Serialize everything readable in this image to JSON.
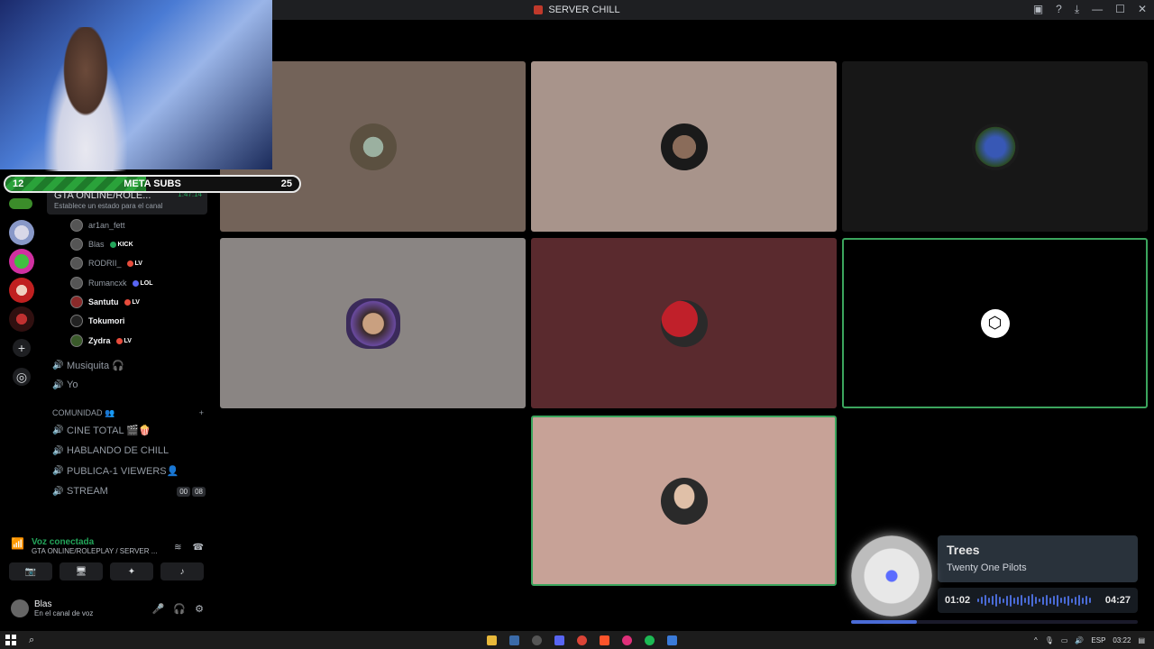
{
  "window": {
    "title": "SERVER CHILL"
  },
  "subgoal": {
    "current": "12",
    "label": "META SUBS",
    "goal": "25",
    "progress": 0.48
  },
  "channel_header": {
    "name": "GTA ONLINE/ROLE...",
    "time": "1:47:14",
    "status": "Establece un estado para el canal"
  },
  "members": [
    {
      "name": "ar1an_fett",
      "badge": "",
      "active": false
    },
    {
      "name": "Blas",
      "badge": "KICK",
      "active": false
    },
    {
      "name": "RODRII_",
      "badge": "LV",
      "active": false
    },
    {
      "name": "Rumancxk",
      "badge": "LOL",
      "active": false
    },
    {
      "name": "Santutu",
      "badge": "LV",
      "active": true
    },
    {
      "name": "Tokumori",
      "badge": "",
      "active": true
    },
    {
      "name": "Zydra",
      "badge": "LV",
      "active": true
    }
  ],
  "voice_channels_top": [
    {
      "name": "Musiquita 🎧"
    },
    {
      "name": "Yo"
    }
  ],
  "category": {
    "name": "COMUNIDAD 👥",
    "add": "+"
  },
  "voice_channels": [
    {
      "name": "CINE TOTAL 🎬🍿"
    },
    {
      "name": "HABLANDO DE CHILL"
    },
    {
      "name": "PUBLICA-1 VIEWERS👤"
    },
    {
      "name": "STREAM",
      "counts": [
        "00",
        "08"
      ]
    }
  ],
  "voice_panel": {
    "status": "Voz conectada",
    "channel": "GTA ONLINE/ROLEPLAY / SERVER ..."
  },
  "user": {
    "name": "Blas",
    "status": "En el canal de voz"
  },
  "music": {
    "song": "Trees",
    "artist": "Twenty One Pilots",
    "elapsed": "01:02",
    "total": "04:27",
    "progress": 0.23
  },
  "taskbar": {
    "lang": "ESP",
    "clock": "03:22"
  },
  "colors": {
    "speaking": "#3ba55d",
    "accent": "#5865f2",
    "bg": "#000000"
  }
}
